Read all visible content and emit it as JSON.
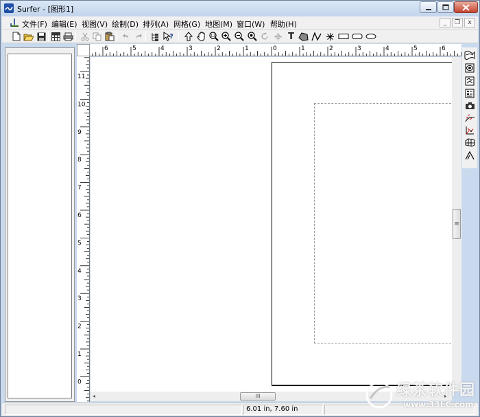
{
  "window": {
    "title": "Surfer - [图形1]",
    "controls": {
      "minimize": "—",
      "maximize": "□",
      "close": "✕"
    }
  },
  "menubar": {
    "items": [
      {
        "label": "文件(F)"
      },
      {
        "label": "编辑(E)"
      },
      {
        "label": "视图(V)"
      },
      {
        "label": "绘制(D)"
      },
      {
        "label": "排列(A)"
      },
      {
        "label": "网格(G)"
      },
      {
        "label": "地图(M)"
      },
      {
        "label": "窗口(W)"
      },
      {
        "label": "帮助(H)"
      }
    ],
    "mdi_controls": {
      "minimize": "_",
      "restore": "❐",
      "close": "x"
    }
  },
  "toolbar": {
    "text_tool_label": "T",
    "icons": [
      "new-icon",
      "open-icon",
      "save-icon",
      "worksheet-icon",
      "print-icon",
      "cut-icon",
      "copy-icon",
      "paste-icon",
      "undo-icon",
      "redo-icon",
      "object-manager-icon",
      "whats-this-icon",
      "select-icon",
      "pan-icon",
      "zoom-in-rect-icon",
      "zoom-in-icon",
      "zoom-out-icon",
      "zoom-fit-icon",
      "rotate-icon",
      "reshape-icon",
      "text-icon",
      "polygon-icon",
      "polyline-icon",
      "symbol-icon",
      "rectangle-icon",
      "rounded-rectangle-icon",
      "ellipse-icon"
    ]
  },
  "ruler": {
    "horizontal_labels": [
      "6",
      "5",
      "4",
      "3",
      "2",
      "1",
      "0",
      "1",
      "2",
      "3",
      "4",
      "5",
      "6"
    ],
    "vertical_labels": [
      "11",
      "10",
      "9",
      "8",
      "7",
      "6",
      "5",
      "4",
      "3",
      "2",
      "1",
      "0"
    ]
  },
  "right_toolbar": {
    "icons": [
      "contour-map-icon",
      "image-map-icon",
      "shaded-relief-icon",
      "post-map-icon",
      "base-map-icon",
      "vector-map-icon",
      "3d-surface-icon",
      "3d-wireframe-icon",
      "variogram-icon"
    ]
  },
  "scrollbars": {
    "vertical_thumb_label": "≡",
    "horizontal_thumb_label": "III",
    "left_arrow": "◂",
    "right_arrow": "▸"
  },
  "statusbar": {
    "coordinates": "6.01 in, 7.60 in"
  },
  "watermark": {
    "text": "绿茶软件园",
    "url": "www.33LC.com"
  }
}
